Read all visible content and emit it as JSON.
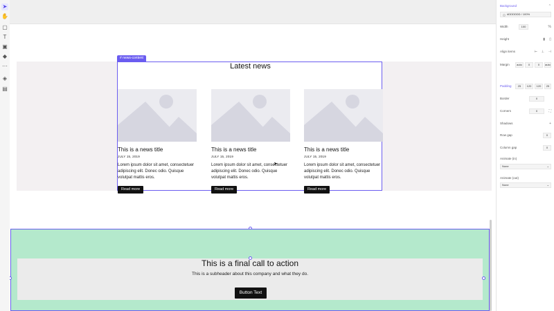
{
  "toolbar": {
    "tools": [
      {
        "icon": "pointer-icon",
        "glyph": "➤"
      },
      {
        "icon": "hand-icon",
        "glyph": "✋"
      },
      {
        "icon": "rectangle-icon",
        "glyph": "▢"
      },
      {
        "icon": "text-icon",
        "glyph": "T"
      },
      {
        "icon": "image-icon",
        "glyph": "▣"
      },
      {
        "icon": "component-icon",
        "glyph": "◆"
      },
      {
        "icon": "more-icon",
        "glyph": "⋯"
      },
      {
        "icon": "layers-icon",
        "glyph": "◈"
      },
      {
        "icon": "pages-icon",
        "glyph": "▤"
      }
    ]
  },
  "canvas": {
    "news_section": {
      "tag": "# news-content",
      "heading": "Latest news",
      "cards": [
        {
          "title": "This is a news title",
          "date": "JULY 15, 2019",
          "body": "Lorem ipsum dolor sit amet, consectetuer adipiscing elit. Donec odio. Quisque volutpat mattis eros.",
          "button": "Read more"
        },
        {
          "title": "This is a news title",
          "date": "JULY 15, 2019",
          "body": "Lorem ipsum dolor sit amet, consectetuer adipiscing elit. Donec odio. Quisque volutpat mattis eros.",
          "button": "Read more"
        },
        {
          "title": "This is a news title",
          "date": "JULY 15, 2019",
          "body": "Lorem ipsum dolor sit amet, consectetuer adipiscing elit. Donec odio. Quisque volutpat mattis eros.",
          "button": "Read more"
        }
      ]
    },
    "cta_section": {
      "title": "This is a final call to action",
      "subtitle": "This is a subheader about this company and what they do.",
      "button": "Button Text"
    }
  },
  "properties_panel": {
    "background": {
      "label": "Background",
      "value": "#DDDDDD / 100%"
    },
    "width": {
      "label": "Width",
      "value": "100"
    },
    "height": {
      "label": "Height"
    },
    "align_items": {
      "label": "Align items"
    },
    "margin": {
      "label": "Margin",
      "auto1": "auto",
      "v1": "0",
      "v2": "0",
      "auto2": "auto"
    },
    "padding": {
      "label": "Padding",
      "values": [
        "25",
        "120",
        "120",
        "25"
      ]
    },
    "border": {
      "label": "Border",
      "value": "0"
    },
    "corners": {
      "label": "Corners",
      "value": "0"
    },
    "shadows": {
      "label": "Shadows"
    },
    "row_gap": {
      "label": "Row gap",
      "value": "0"
    },
    "column_gap": {
      "label": "Column gap",
      "value": "0"
    },
    "animate_in": {
      "label": "Animate (in)",
      "value": "None"
    },
    "animate_out": {
      "label": "Animate (out)",
      "value": "None"
    }
  },
  "colors": {
    "accent": "#6a5cf0",
    "news_band": "#f3f0f2",
    "cta_bg": "#b4e9cc",
    "cta_inner": "#ebebeb",
    "button": "#111111"
  }
}
